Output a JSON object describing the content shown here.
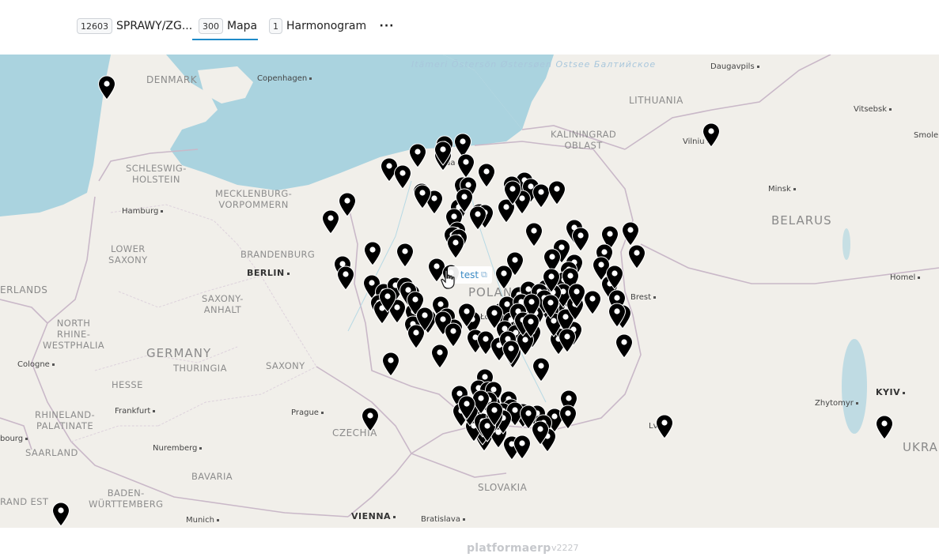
{
  "tabs": [
    {
      "count": "12603",
      "label": "SPRAWY/ZG..."
    },
    {
      "count": "300",
      "label": "Mapa",
      "active": true
    },
    {
      "count": "1",
      "label": "Harmonogram"
    }
  ],
  "more_label": "···",
  "map": {
    "countries": {
      "denmark": "DENMARK",
      "lithuania": "LITHUANIA",
      "belarus": "BELARUS",
      "germany": "GERMANY",
      "poland": "POLAND",
      "czechia": "CZECHIA",
      "slovakia": "SLOVAKIA",
      "ukraine": "UKRAI",
      "netherlands": "ERLANDS"
    },
    "regions": {
      "kaliningrad": "KALININGRAD\nOBLAST",
      "schleswig": "SCHLESWIG-\nHOLSTEIN",
      "mecklenburg": "MECKLENBURG-\nVORPOMMERN",
      "lower_saxony": "LOWER\nSAXONY",
      "brandenburg": "BRANDENBURG",
      "saxony_anhalt": "SAXONY-\nANHALT",
      "nrw": "NORTH\nRHINE-\nWESTPHALIA",
      "thuringia": "THURINGIA",
      "saxony": "SAXONY",
      "hesse": "HESSE",
      "rhineland": "RHINELAND-\nPALATINATE",
      "saarland": "SAARLAND",
      "bavaria": "BAVARIA",
      "baden": "BADEN-\nWÜRTTEMBERG",
      "grand_est": "RAND EST"
    },
    "seas": {
      "baltic": "Itämeri\nÖstersön\nØstersøen\nOstsee\nБалтийское"
    },
    "cities": {
      "copenhagen": "Copenhagen",
      "hamburg": "Hamburg",
      "berlin": "BERLIN",
      "cologne": "Cologne",
      "frankfurt": "Frankfurt",
      "prague": "Prague",
      "nuremberg": "Nuremberg",
      "munich": "Munich",
      "vienna": "VIENNA",
      "bratislava": "Bratislava",
      "vilnius": "Vilniu",
      "minsk": "Minsk",
      "daugavpils": "Daugavpils",
      "vitsebsk": "Vitsebsk",
      "smole": "Smole",
      "homel": "Homel",
      "brest": "Brest",
      "zhytomyr": "Zhytomyr",
      "kyiv": "KYIV",
      "lodz": "Łód",
      "gdansk": "da",
      "lviv": "Lv",
      "bourg": "bourg"
    },
    "tooltip": {
      "label": "test",
      "icon": "external-link-icon"
    },
    "marker_icon": "map-pin-icon",
    "marker_count_visible": 181
  },
  "footer": {
    "logo": "platformaerp",
    "version": "v2227"
  },
  "colors": {
    "accent": "#1e8ac8",
    "land": "#f1efea",
    "water": "#aad3df",
    "marker": "#000000",
    "link": "#3a8ac4"
  }
}
